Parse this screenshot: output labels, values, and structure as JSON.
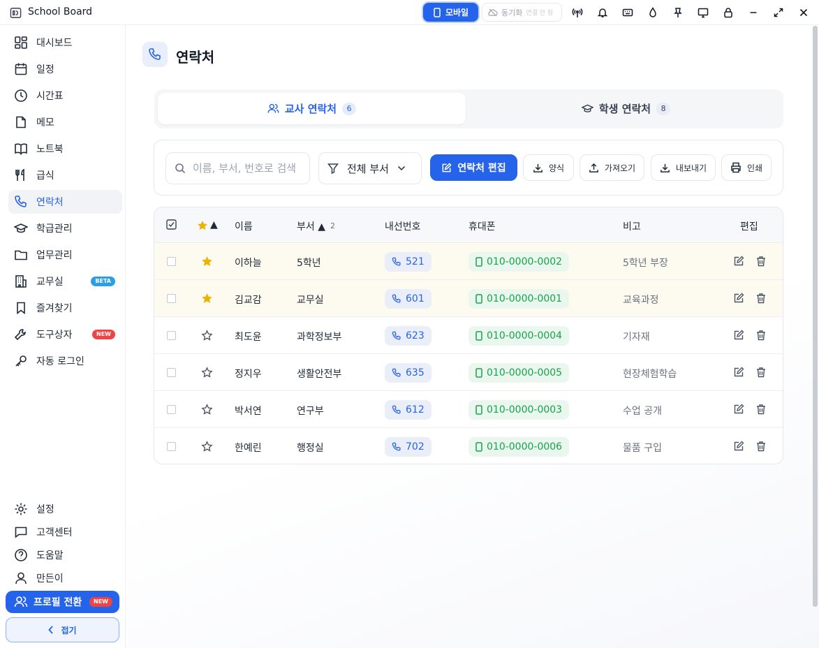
{
  "app": {
    "title": "School Board"
  },
  "titlebar": {
    "mobile_label": "모바일",
    "sync_label": "동기화",
    "sync_sub": "연결 안 됨",
    "icons": [
      "antenna-icon",
      "bell-icon",
      "keyboard-icon",
      "drop-icon",
      "pin-icon",
      "monitor-icon",
      "lock-icon",
      "minimize-icon",
      "maximize-icon",
      "close-icon"
    ]
  },
  "sidebar": {
    "items": [
      {
        "label": "대시보드",
        "icon": "dashboard-icon"
      },
      {
        "label": "일정",
        "icon": "calendar-icon"
      },
      {
        "label": "시간표",
        "icon": "clock-icon"
      },
      {
        "label": "메모",
        "icon": "memo-icon"
      },
      {
        "label": "노트북",
        "icon": "book-icon"
      },
      {
        "label": "급식",
        "icon": "utensils-icon"
      },
      {
        "label": "연락처",
        "icon": "phone-icon",
        "active": true
      },
      {
        "label": "학급관리",
        "icon": "graduation-cap-icon"
      },
      {
        "label": "업무관리",
        "icon": "folder-icon"
      },
      {
        "label": "교무실",
        "icon": "building-icon",
        "badge": "BETA"
      },
      {
        "label": "즐겨찾기",
        "icon": "bookmark-icon"
      },
      {
        "label": "도구상자",
        "icon": "wrench-icon",
        "badge": "NEW"
      },
      {
        "label": "자동 로그인",
        "icon": "key-icon"
      }
    ],
    "bottom_items": [
      {
        "label": "설정",
        "icon": "gear-icon"
      },
      {
        "label": "고객센터",
        "icon": "chat-icon"
      },
      {
        "label": "도움말",
        "icon": "help-icon"
      },
      {
        "label": "만든이",
        "icon": "user-icon"
      }
    ],
    "profile_switch": {
      "label": "프로필 전환",
      "badge": "NEW"
    },
    "collapse_label": "접기"
  },
  "page": {
    "title": "연락처"
  },
  "tabs": [
    {
      "label": "교사 연락처",
      "count": "6",
      "active": true
    },
    {
      "label": "학생 연락처",
      "count": "8",
      "active": false
    }
  ],
  "toolbar": {
    "search_placeholder": "이름, 부서, 번호로 검색",
    "dept_filter": "전체 부서",
    "edit_label": "연락처 편집",
    "template_label": "양식",
    "import_label": "가져오기",
    "export_label": "내보내기",
    "print_label": "인쇄"
  },
  "table": {
    "headers": {
      "star_sort": "▲",
      "name": "이름",
      "dept": "부서 ▲",
      "dept_sort_order": "2",
      "ext": "내선번호",
      "phone": "휴대폰",
      "note": "비고",
      "edit": "편집"
    },
    "rows": [
      {
        "fav": true,
        "name": "이하늘",
        "dept": "5학년",
        "ext": "521",
        "phone": "010-0000-0002",
        "note": "5학년 부장"
      },
      {
        "fav": true,
        "name": "김교감",
        "dept": "교무실",
        "ext": "601",
        "phone": "010-0000-0001",
        "note": "교육과정"
      },
      {
        "fav": false,
        "name": "최도윤",
        "dept": "과학정보부",
        "ext": "623",
        "phone": "010-0000-0004",
        "note": "기자재"
      },
      {
        "fav": false,
        "name": "정지우",
        "dept": "생활안전부",
        "ext": "635",
        "phone": "010-0000-0005",
        "note": "현장체험학습"
      },
      {
        "fav": false,
        "name": "박서연",
        "dept": "연구부",
        "ext": "612",
        "phone": "010-0000-0003",
        "note": "수업 공개"
      },
      {
        "fav": false,
        "name": "한예린",
        "dept": "행정실",
        "ext": "702",
        "phone": "010-0000-0006",
        "note": "물품 구입"
      }
    ]
  },
  "colors": {
    "accent": "#2563eb",
    "favorite": "#eab308",
    "phone_green": "#16a34a"
  }
}
